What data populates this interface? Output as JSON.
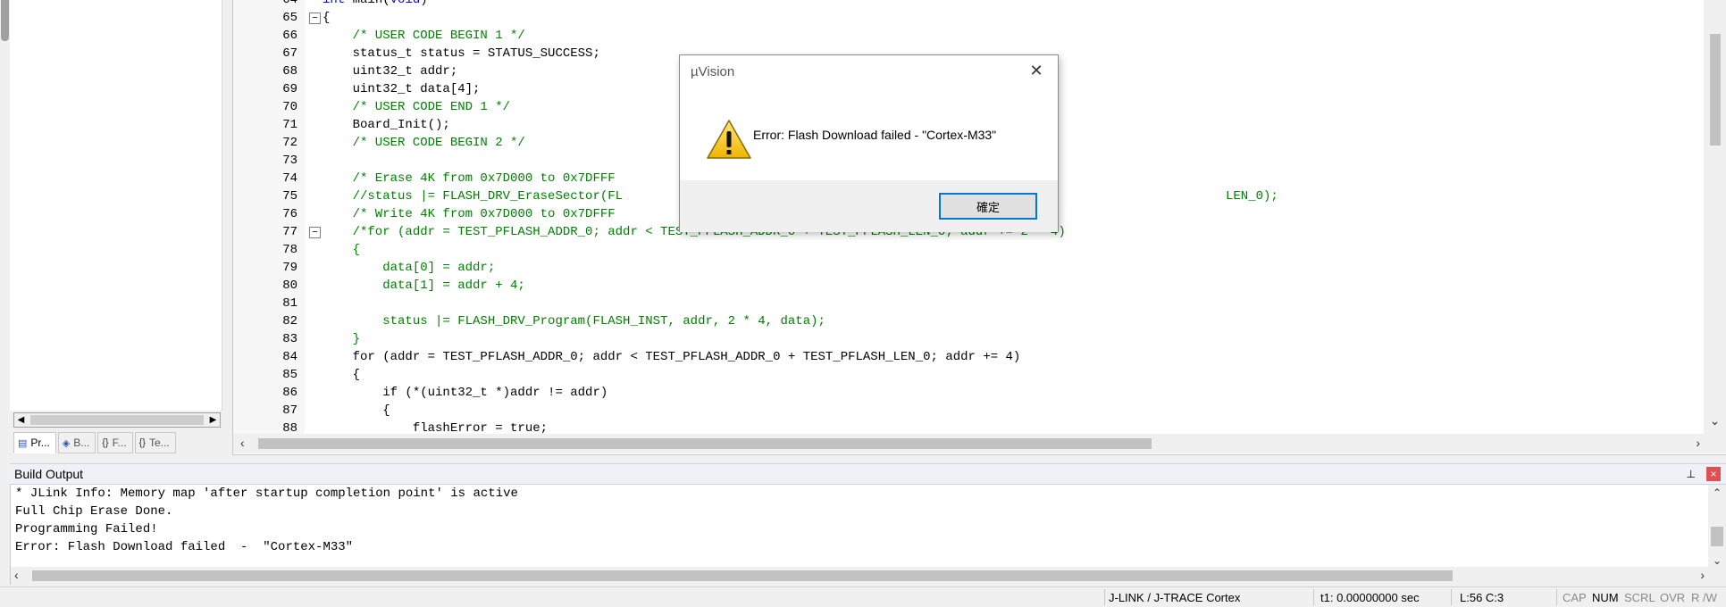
{
  "project_tabs": [
    {
      "label": "Pr...",
      "icon": "project-icon"
    },
    {
      "label": "B...",
      "icon": "books-icon"
    },
    {
      "label": "F...",
      "icon": "functions-icon"
    },
    {
      "label": "Te...",
      "icon": "templates-icon"
    }
  ],
  "editor": {
    "lines": [
      {
        "n": "64",
        "text": "int main(void)"
      },
      {
        "n": "65",
        "text": "{"
      },
      {
        "n": "66",
        "text": "    /* USER CODE BEGIN 1 */"
      },
      {
        "n": "67",
        "text": "    status_t status = STATUS_SUCCESS;"
      },
      {
        "n": "68",
        "text": "    uint32_t addr;"
      },
      {
        "n": "69",
        "text": "    uint32_t data[4];"
      },
      {
        "n": "70",
        "text": "    /* USER CODE END 1 */"
      },
      {
        "n": "71",
        "text": "    Board_Init();"
      },
      {
        "n": "72",
        "text": "    /* USER CODE BEGIN 2 */"
      },
      {
        "n": "73",
        "text": ""
      },
      {
        "n": "74",
        "text": "    /* Erase 4K from 0x7D000 to 0x7DFFF"
      },
      {
        "n": "75",
        "text": "    //status |= FLASH_DRV_EraseSector(FL"
      },
      {
        "n": "76",
        "text": "    /* Write 4K from 0x7D000 to 0x7DFFF"
      },
      {
        "n": "77",
        "text": "    /*for (addr = TEST_PFLASH_ADDR_0; addr < TEST_PFLASH_ADDR_0 + TEST_PFLASH_LEN_0; addr += 2 * 4)"
      },
      {
        "n": "78",
        "text": "    {"
      },
      {
        "n": "79",
        "text": "        data[0] = addr;"
      },
      {
        "n": "80",
        "text": "        data[1] = addr + 4;"
      },
      {
        "n": "81",
        "text": ""
      },
      {
        "n": "82",
        "text": "        status |= FLASH_DRV_Program(FLASH_INST, addr, 2 * 4, data);"
      },
      {
        "n": "83",
        "text": "    }"
      },
      {
        "n": "84",
        "text": "    for (addr = TEST_PFLASH_ADDR_0; addr < TEST_PFLASH_ADDR_0 + TEST_PFLASH_LEN_0; addr += 4)"
      },
      {
        "n": "85",
        "text": "    {"
      },
      {
        "n": "86",
        "text": "        if (*(uint32_t *)addr != addr)"
      },
      {
        "n": "87",
        "text": "        {"
      },
      {
        "n": "88",
        "text": "            flashError = true;"
      }
    ],
    "line75_tail": "LEN_0);"
  },
  "build_output": {
    "title": "Build Output",
    "pin": "ꟷ",
    "close": "×",
    "lines": [
      "* JLink Info: Memory map 'after startup completion point' is active",
      "Full Chip Erase Done.",
      "Programming Failed!",
      "Error: Flash Download failed  -  \"Cortex-M33\""
    ]
  },
  "statusbar": {
    "debugger": "J-LINK / J-TRACE Cortex",
    "time": "t1: 0.00000000 sec",
    "position": "L:56 C:3",
    "indicators": [
      {
        "label": "CAP",
        "active": false
      },
      {
        "label": "NUM",
        "active": true
      },
      {
        "label": "SCRL",
        "active": false
      },
      {
        "label": "OVR",
        "active": false
      },
      {
        "label": "R /W",
        "active": false
      }
    ]
  },
  "dialog": {
    "title": "µVision",
    "message": "Error: Flash Download failed  -  \"Cortex-M33\"",
    "ok_label": "確定",
    "icon": "warning-icon"
  },
  "colors": {
    "comment": "#008000",
    "keyword": "#0000ff",
    "accent": "#0078d7"
  }
}
